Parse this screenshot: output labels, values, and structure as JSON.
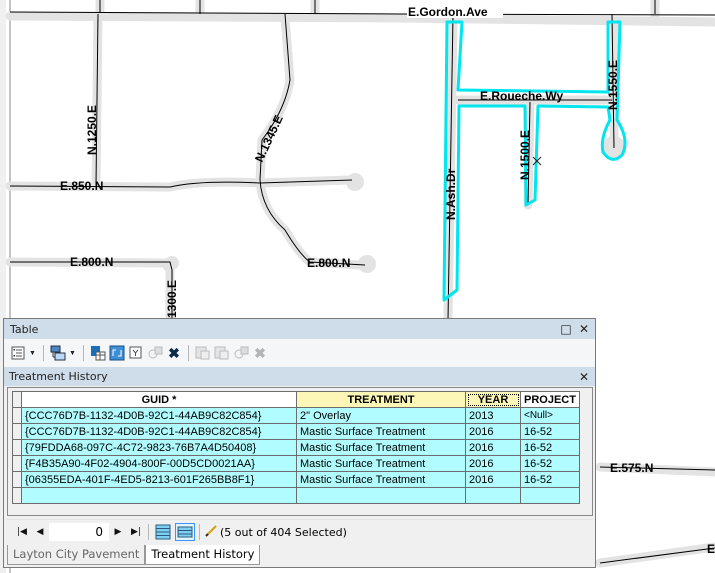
{
  "map": {
    "labels": {
      "gordon": "E.Gordon.Ave",
      "n1250": "N.1250.E",
      "n1345": "N.1345.E",
      "e850": "E.850.N",
      "e800a": "E.800.N",
      "e800b": "E.800.N",
      "n1300": "1300.E",
      "ash": "N.Ash.Dr",
      "roueche": "E.Roueche.Wy",
      "n1500": "N.1500.E",
      "n1550": "N.1550.E",
      "e575": "E.575.N",
      "e_partial": "E"
    },
    "colors": {
      "selection": "#00e5ee",
      "road_casing": "#e3e3e3",
      "road_line": "#000000"
    }
  },
  "table_window": {
    "title": "Table",
    "maximize_icon": "□",
    "close_icon": "✕",
    "toolbar": [
      "table-options-icon",
      "related-tables-icon",
      "select-by-attributes-icon",
      "switch-selection-icon",
      "clear-selection-icon",
      "zoom-to-selected-icon",
      "delete-selected-icon",
      "copy-selected-icon",
      "paste-icon",
      "zoom-icon",
      "delete-icon"
    ],
    "subtable_title": "Treatment History",
    "subtable_close": "✕",
    "columns": [
      "GUID *",
      "TREATMENT",
      "YEAR",
      "PROJECT"
    ],
    "rows": [
      [
        "{CCC76D7B-1132-4D0B-92C1-44AB9C82C854}",
        "2\" Overlay",
        "2013",
        "<Null>"
      ],
      [
        "{CCC76D7B-1132-4D0B-92C1-44AB9C82C854}",
        "Mastic Surface Treatment",
        "2016",
        "16-52"
      ],
      [
        "{79FDDA68-097C-4C72-9823-76B7A4D50408}",
        "Mastic Surface Treatment",
        "2016",
        "16-52"
      ],
      [
        "{F4B35A90-4F02-4904-800F-00D5CD0021AA}",
        "Mastic Surface Treatment",
        "2016",
        "16-52"
      ],
      [
        "{06355EDA-401F-4ED5-8213-601F265BB8F1}",
        "Mastic Surface Treatment",
        "2016",
        "16-52"
      ],
      [
        "",
        "",
        "",
        ""
      ]
    ],
    "navigation": {
      "record": "0",
      "status": "(5 out of 404 Selected)"
    },
    "tabs": [
      {
        "label": "Layton City Pavement",
        "active": false
      },
      {
        "label": "Treatment History",
        "active": true
      }
    ]
  }
}
